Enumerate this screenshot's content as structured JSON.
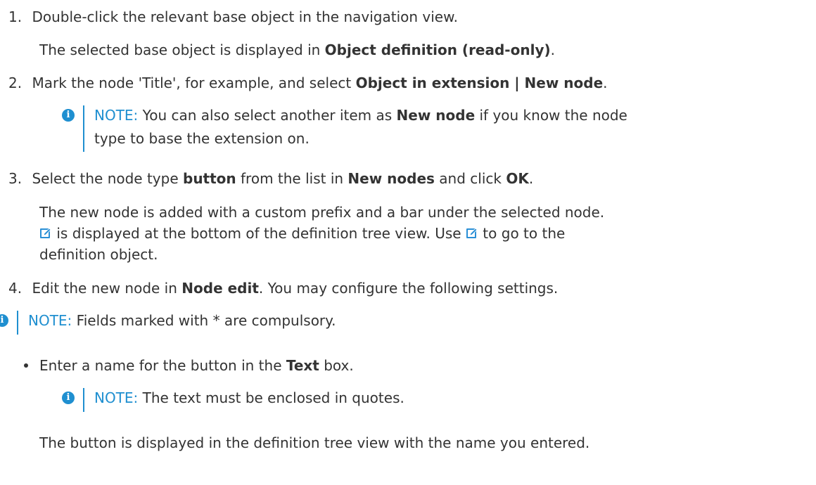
{
  "steps": [
    {
      "num": "1.",
      "text": "Double-click the relevant base object in the navigation view."
    },
    {
      "num": "2.",
      "text_a": "Mark the node 'Title', for example, and select ",
      "bold": "Object in extension | New node",
      "text_b": "."
    },
    {
      "num": "3.",
      "text_a": "Select the node type ",
      "bold1": "button",
      "text_b": " from the list in ",
      "bold2": "New nodes",
      "text_c": " and click ",
      "bold3": "OK",
      "text_d": "."
    },
    {
      "num": "4.",
      "text_a": "Edit the new node in ",
      "bold": "Node edit",
      "text_b": ". You may configure the following settings."
    }
  ],
  "sub1": {
    "text_a": "The selected base object is displayed in ",
    "bold": "Object definition (read-only)",
    "text_b": "."
  },
  "note1": {
    "label": "NOTE:",
    "text_a": " You can also select another item as ",
    "bold": "New node",
    "text_b": " if you know the node",
    "line2": "type to base the extension on."
  },
  "sub3": {
    "line1": "The new node is added with a custom prefix and a bar under the selected node.",
    "line2_b": " is displayed at the bottom of the definition tree view. Use ",
    "line2_d": " to go to the",
    "line3": "definition object."
  },
  "note2": {
    "label": "NOTE:",
    "text": " Fields marked with * are compulsory."
  },
  "bullet": {
    "text_a": "Enter a name for the button in the ",
    "bold": "Text",
    "text_b": " box."
  },
  "note3": {
    "label": "NOTE:",
    "text": " The text must be enclosed in quotes."
  },
  "final": "The button is displayed in the definition tree view with the name you entered.",
  "colors": {
    "note_accent": "#1f8fd0",
    "text": "#333333",
    "edit_icon": "#2a8fd6"
  },
  "icons": {
    "info": "info-icon",
    "edit": "edit-icon"
  }
}
